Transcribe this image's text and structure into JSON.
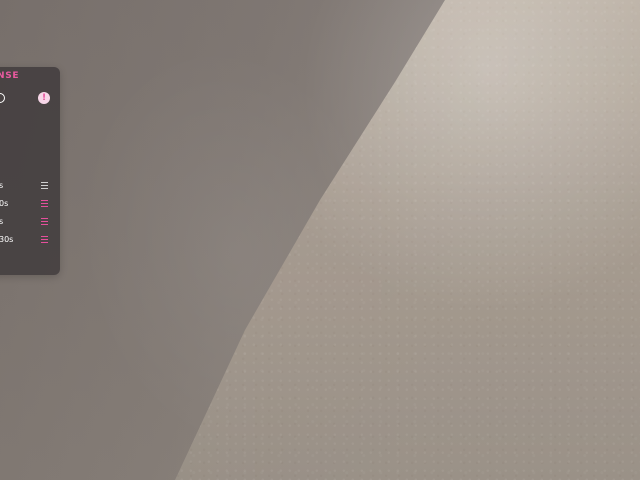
{
  "panel": {
    "brand_text": "NSE",
    "accent_color": "#e6509b",
    "timer_rows": [
      {
        "label": "s"
      },
      {
        "label": "0s"
      },
      {
        "label": "s"
      },
      {
        "label": "30s"
      }
    ],
    "graph_rows": [
      {
        "label": "s",
        "icon": "ramp-up-icon"
      },
      {
        "label": "s",
        "icon": "step-up-icon"
      },
      {
        "label": "s",
        "icon": "wave-icon"
      }
    ]
  }
}
